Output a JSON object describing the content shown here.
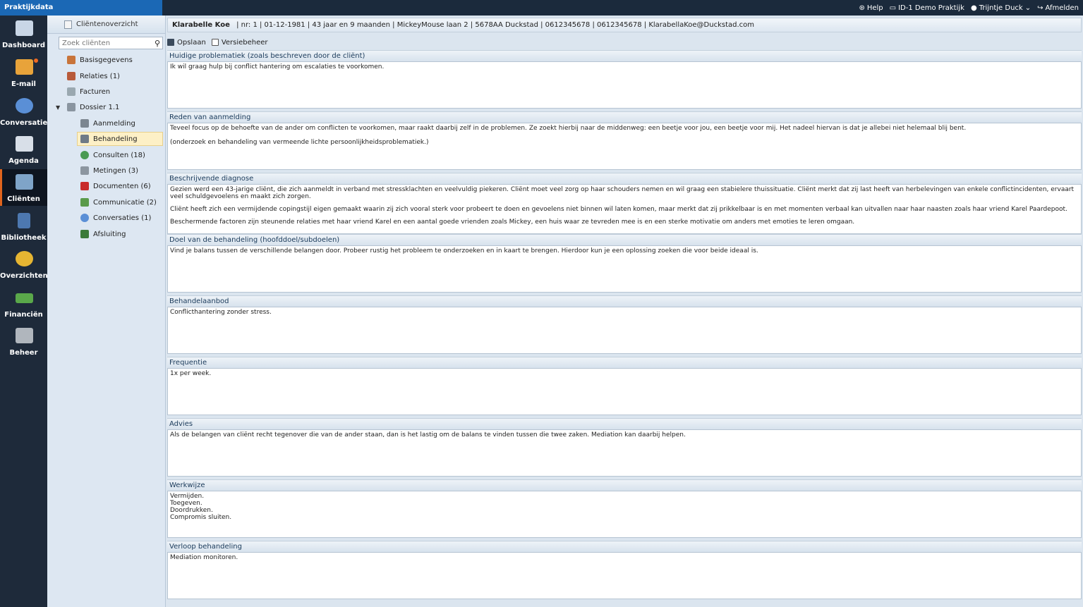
{
  "app": {
    "brand": "Praktijkdata"
  },
  "topnav": {
    "help": "Help",
    "practice": "ID-1 Demo Praktijk",
    "user": "Trijntje Duck",
    "logout": "Afmelden"
  },
  "leftnav": [
    {
      "label": "Dashboard",
      "icon": "dashboard-icon",
      "color": "#c9d6e6"
    },
    {
      "label": "E-mail",
      "icon": "email-icon",
      "color": "#e8a33a"
    },
    {
      "label": "Conversaties",
      "icon": "chat-bubble-icon",
      "color": "#5a8fd6"
    },
    {
      "label": "Agenda",
      "icon": "calendar-icon",
      "color": "#d8dfe8"
    },
    {
      "label": "Cliënten",
      "icon": "clients-icon",
      "color": "#7fa4c8"
    },
    {
      "label": "Bibliotheek",
      "icon": "library-icon",
      "color": "#4d78b0"
    },
    {
      "label": "Overzichten",
      "icon": "pie-chart-icon",
      "color": "#e6b532"
    },
    {
      "label": "Financiën",
      "icon": "money-icon",
      "color": "#5aa84a"
    },
    {
      "label": "Beheer",
      "icon": "tools-icon",
      "color": "#b0b6bd"
    }
  ],
  "clientpanel": {
    "header": "Cliëntenoverzicht",
    "search_placeholder": "Zoek cliënten",
    "tree": [
      {
        "label": "Basisgegevens",
        "icon": "person-icon",
        "color": "#c8743a"
      },
      {
        "label": "Relaties (1)",
        "icon": "relations-icon",
        "color": "#b85a3a"
      },
      {
        "label": "Facturen",
        "icon": "invoice-icon",
        "color": "#9aa8b0"
      },
      {
        "label": "Dossier 1.1",
        "icon": "dossier-icon",
        "color": "#8a95a0"
      },
      {
        "label": "Aanmelding",
        "icon": "registration-icon",
        "color": "#7c8690"
      },
      {
        "label": "Behandeling",
        "icon": "treatment-icon",
        "color": "#6e7a86"
      },
      {
        "label": "Consulten (18)",
        "icon": "consult-icon",
        "color": "#4a9a52"
      },
      {
        "label": "Metingen (3)",
        "icon": "measurement-icon",
        "color": "#8c96a0"
      },
      {
        "label": "Documenten (6)",
        "icon": "documents-icon",
        "color": "#c82a2a"
      },
      {
        "label": "Communicatie (2)",
        "icon": "communication-icon",
        "color": "#5a9a4a"
      },
      {
        "label": "Conversaties (1)",
        "icon": "conversation-icon",
        "color": "#5a8fd6"
      },
      {
        "label": "Afsluiting",
        "icon": "closing-icon",
        "color": "#3a7a3a"
      }
    ]
  },
  "client_info": {
    "name": "Klarabelle Koe",
    "details": "| nr: 1  | 01-12-1981  | 43 jaar en 9 maanden  | MickeyMouse laan 2  | 5678AA Duckstad  | 0612345678 | 0612345678 | KlarabellaKoe@Duckstad.com"
  },
  "toolbar": {
    "save": "Opslaan",
    "versions": "Versiebeheer"
  },
  "sections": [
    {
      "title": "Huidige problematiek (zoals beschreven door de cliënt)",
      "paragraphs": [
        "Ik wil graag hulp bij conflict hantering om escalaties te voorkomen."
      ]
    },
    {
      "title": "Reden van aanmelding",
      "paragraphs": [
        "Teveel focus op de behoefte van de ander om conflicten te voorkomen, maar raakt daarbij zelf in de problemen. Ze zoekt hierbij naar de middenweg: een beetje voor jou, een beetje voor mij. Het nadeel hiervan is dat je allebei niet helemaal blij bent.",
        "(onderzoek en behandeling van vermeende lichte persoonlijkheidsproblematiek.)"
      ]
    },
    {
      "title": "Beschrijvende diagnose",
      "paragraphs": [
        "Gezien werd een 43-jarige cliënt, die zich aanmeldt in verband met stressklachten en veelvuldig piekeren. Cliënt moet veel zorg op haar schouders nemen en wil graag een stabielere thuissituatie. Cliënt merkt dat zij last heeft van herbelevingen van enkele conflictincidenten, ervaart veel schuldgevoelens en maakt zich zorgen.",
        "Cliënt heeft zich een vermijdende copingstijl eigen gemaakt waarin zij zich vooral sterk voor probeert te doen en gevoelens niet binnen wil laten komen, maar merkt dat zij prikkelbaar is en met momenten verbaal kan uitvallen naar haar naasten zoals haar vriend Karel Paardepoot.",
        "Beschermende factoren zijn steunende relaties met haar vriend Karel en een aantal goede vrienden zoals Mickey, een huis waar ze tevreden mee is en een sterke motivatie om anders met emoties te leren omgaan."
      ]
    },
    {
      "title": "Doel van de behandeling (hoofddoel/subdoelen)",
      "paragraphs": [
        "Vind je balans tussen de verschillende belangen door. Probeer rustig het probleem te onderzoeken en in kaart te brengen. Hierdoor kun je een oplossing zoeken die voor beide ideaal is."
      ]
    },
    {
      "title": "Behandelaanbod",
      "paragraphs": [
        "Conflicthantering zonder stress."
      ]
    },
    {
      "title": "Frequentie",
      "paragraphs": [
        "1x per week."
      ]
    },
    {
      "title": "Advies",
      "paragraphs": [
        "Als de belangen van cliënt recht tegenover die van de ander staan, dan is het lastig om de balans te vinden tussen die twee zaken. Mediation kan daarbij helpen."
      ]
    },
    {
      "title": "Werkwijze",
      "lines": [
        "Vermijden.",
        "Toegeven.",
        "Doordrukken.",
        "Compromis sluiten."
      ]
    },
    {
      "title": "Verloop behandeling",
      "paragraphs": [
        "Mediation monitoren."
      ]
    }
  ]
}
